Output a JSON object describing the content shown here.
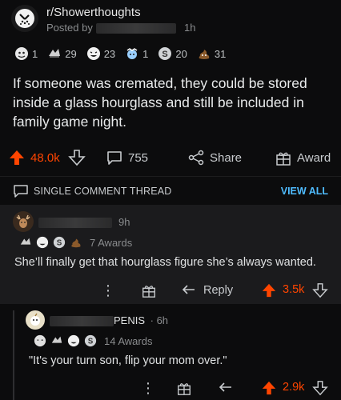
{
  "post": {
    "subreddit": "r/Showerthoughts",
    "posted_by_label": "Posted by",
    "time": "1h",
    "awards": [
      {
        "icon": "ghost-award-icon",
        "count": "1"
      },
      {
        "icon": "hands-award-icon",
        "count": "29"
      },
      {
        "icon": "laughing-award-icon",
        "count": "23"
      },
      {
        "icon": "mindblown-award-icon",
        "count": "1"
      },
      {
        "icon": "silver-coin-award-icon",
        "count": "20"
      },
      {
        "icon": "poop-award-icon",
        "count": "31"
      }
    ],
    "title": "If someone was cremated, they could be stored inside a glass hourglass and still be included in family game night.",
    "upvotes": "48.0k",
    "comments": "755",
    "share_label": "Share",
    "award_label": "Award"
  },
  "thread": {
    "label": "SINGLE COMMENT THREAD",
    "view_all": "VIEW ALL"
  },
  "comment1": {
    "time": "9h",
    "awards_label": "7 Awards",
    "text": "She’ll finally get that hourglass figure she’s always wanted.",
    "reply_label": "Reply",
    "score": "3.5k"
  },
  "comment2": {
    "username_suffix": "PENIS",
    "time": "· 6h",
    "awards_label": "14 Awards",
    "text": "\"It's your turn son, flip your mom over.\"",
    "score": "2.9k"
  },
  "colors": {
    "accent": "#ff4500",
    "link": "#4fbcff",
    "background": "#0c0c0d",
    "highlight": "#1b1b1d"
  }
}
